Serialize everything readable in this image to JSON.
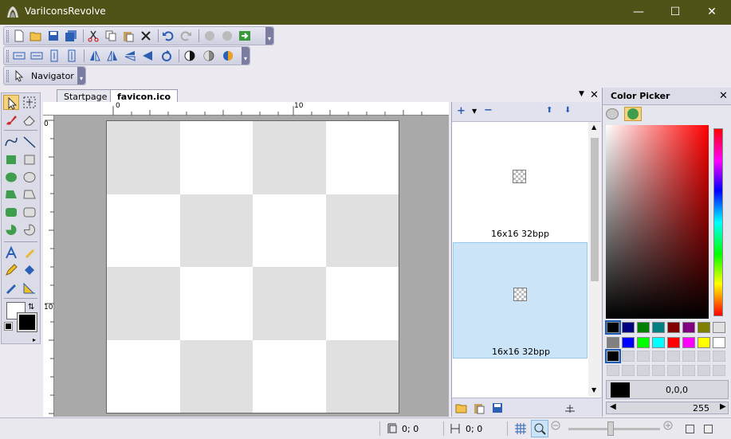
{
  "window": {
    "title": "VariIconsRevolve",
    "minimize": "—",
    "maximize": "☐",
    "close": "✕"
  },
  "toolbar_navigator": {
    "label": "Navigator"
  },
  "tabs": [
    {
      "label": "Startpage",
      "active": false
    },
    {
      "label": "favicon.ico",
      "active": true
    }
  ],
  "tab_controls": {
    "dropdown": "▼",
    "close": "✕"
  },
  "ruler": {
    "h_labels": [
      "0",
      "10"
    ],
    "v_labels": [
      "0",
      "10"
    ]
  },
  "formats": {
    "items": [
      {
        "label": "16x16 32bpp",
        "selected": false
      },
      {
        "label": "16x16 32bpp",
        "selected": true
      }
    ]
  },
  "color_picker": {
    "title": "Color Picker",
    "close": "✕",
    "rgb_value": "0,0,0",
    "alpha_value": "255",
    "palette_row1": [
      "#000000",
      "#000080",
      "#008000",
      "#008080",
      "#800000",
      "#800080",
      "#808000",
      "#e0e0e0"
    ],
    "palette_row2": [
      "#808080",
      "#0000ff",
      "#00ff00",
      "#00ffff",
      "#ff0000",
      "#ff00ff",
      "#ffff00",
      "#ffffff"
    ]
  },
  "status": {
    "position": "0; 0",
    "size": "0; 0"
  },
  "colors": {
    "titlebar": "#4f5318",
    "selection": "#cce4f7",
    "accent": "#1e5cb3"
  }
}
